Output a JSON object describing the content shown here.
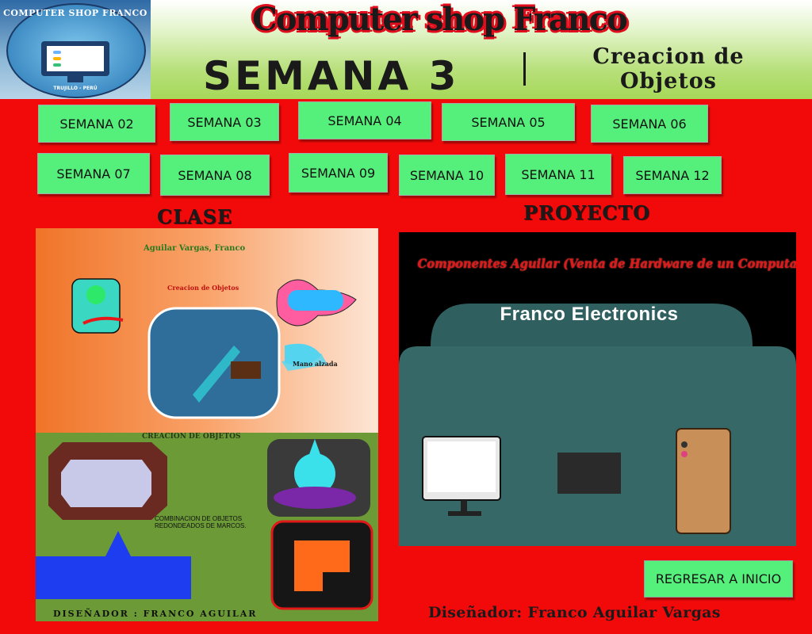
{
  "header": {
    "logo_text": "COMPUTER SHOP FRANCO",
    "logo_subtext": "TRUJILLO - PERÚ",
    "site_title": "Computer shop Franco",
    "week_title": "SEMANA 3",
    "topic": "Creacion de Objetos"
  },
  "weeks": [
    {
      "label": "SEMANA 02"
    },
    {
      "label": "SEMANA 03"
    },
    {
      "label": "SEMANA 04"
    },
    {
      "label": "SEMANA 05"
    },
    {
      "label": "SEMANA 06"
    },
    {
      "label": "SEMANA 07"
    },
    {
      "label": "SEMANA 08"
    },
    {
      "label": "SEMANA 09"
    },
    {
      "label": "SEMANA 10"
    },
    {
      "label": "SEMANA 11"
    },
    {
      "label": "SEMANA 12"
    }
  ],
  "sections": {
    "class": "CLASE",
    "project": "PROYECTO"
  },
  "class_image": {
    "author": "Aguilar Vargas, Franco",
    "subtitle": "Creacion de Objetos",
    "raised_hand": "Mano alzada",
    "bottom_title": "CREACION DE OBJETOS",
    "combination_text": "COMBINACION DE OBJETOS REDONDEADOS DE MARCOS.",
    "designer_strip": "DISEÑADOR : FRANCO AGUILAR"
  },
  "project_image": {
    "heading": "Componentes Aguilar (Venta de Hardware de un Computadora)",
    "store_name": "Franco Electronics"
  },
  "footer": {
    "back_button": "REGRESAR A INICIO",
    "designer": "Diseñador: Franco Aguilar Vargas"
  },
  "colors": {
    "background": "#f20a0a",
    "button": "#55f07b",
    "title_shadow": "#e00e1c"
  }
}
